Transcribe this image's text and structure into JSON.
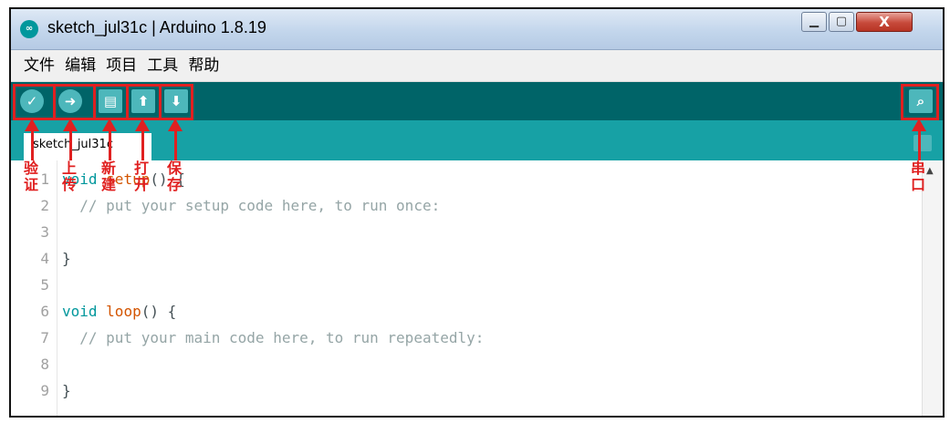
{
  "window": {
    "title": "sketch_jul31c | Arduino 1.8.19",
    "app_icon": "arduino-logo-icon",
    "controls": {
      "minimize": "minimize-icon",
      "maximize": "maximize-icon",
      "close": "X"
    }
  },
  "menubar": {
    "items": [
      {
        "label": "文件"
      },
      {
        "label": "编辑"
      },
      {
        "label": "项目"
      },
      {
        "label": "工具"
      },
      {
        "label": "帮助"
      }
    ]
  },
  "toolbar": {
    "buttons": [
      {
        "name": "verify",
        "icon": "check-icon",
        "glyph": "✓"
      },
      {
        "name": "upload",
        "icon": "arrow-right-icon",
        "glyph": "➜"
      },
      {
        "name": "new",
        "icon": "new-file-icon",
        "glyph": "▤"
      },
      {
        "name": "open",
        "icon": "arrow-up-icon",
        "glyph": "⬆"
      },
      {
        "name": "save",
        "icon": "arrow-down-icon",
        "glyph": "⬇"
      }
    ],
    "serial_monitor": {
      "icon": "serial-monitor-icon",
      "glyph": "⌕"
    }
  },
  "tabs": [
    {
      "label": "sketch_jul31c"
    }
  ],
  "editor": {
    "lines": [
      {
        "num": "1",
        "keyword": "void",
        "func": "setup",
        "rest": "() {",
        "comment": ""
      },
      {
        "num": "2",
        "keyword": "",
        "func": "",
        "rest": "  ",
        "comment": "// put your setup code here, to run once:"
      },
      {
        "num": "3",
        "keyword": "",
        "func": "",
        "rest": "",
        "comment": ""
      },
      {
        "num": "4",
        "keyword": "",
        "func": "",
        "rest": "}",
        "comment": ""
      },
      {
        "num": "5",
        "keyword": "",
        "func": "",
        "rest": "",
        "comment": ""
      },
      {
        "num": "6",
        "keyword": "void",
        "func": "loop",
        "rest": "() {",
        "comment": ""
      },
      {
        "num": "7",
        "keyword": "",
        "func": "",
        "rest": "  ",
        "comment": "// put your main code here, to run repeatedly:"
      },
      {
        "num": "8",
        "keyword": "",
        "func": "",
        "rest": "",
        "comment": ""
      },
      {
        "num": "9",
        "keyword": "",
        "func": "",
        "rest": "}",
        "comment": ""
      }
    ]
  },
  "annotations": {
    "verify": "验证",
    "upload": "上传",
    "new": "新建",
    "open": "打开",
    "save": "保存",
    "serial": "串口"
  },
  "colors": {
    "toolbar": "#006468",
    "tabbar": "#17a1a5",
    "button": "#4db7bb",
    "annotation": "#e02020"
  }
}
